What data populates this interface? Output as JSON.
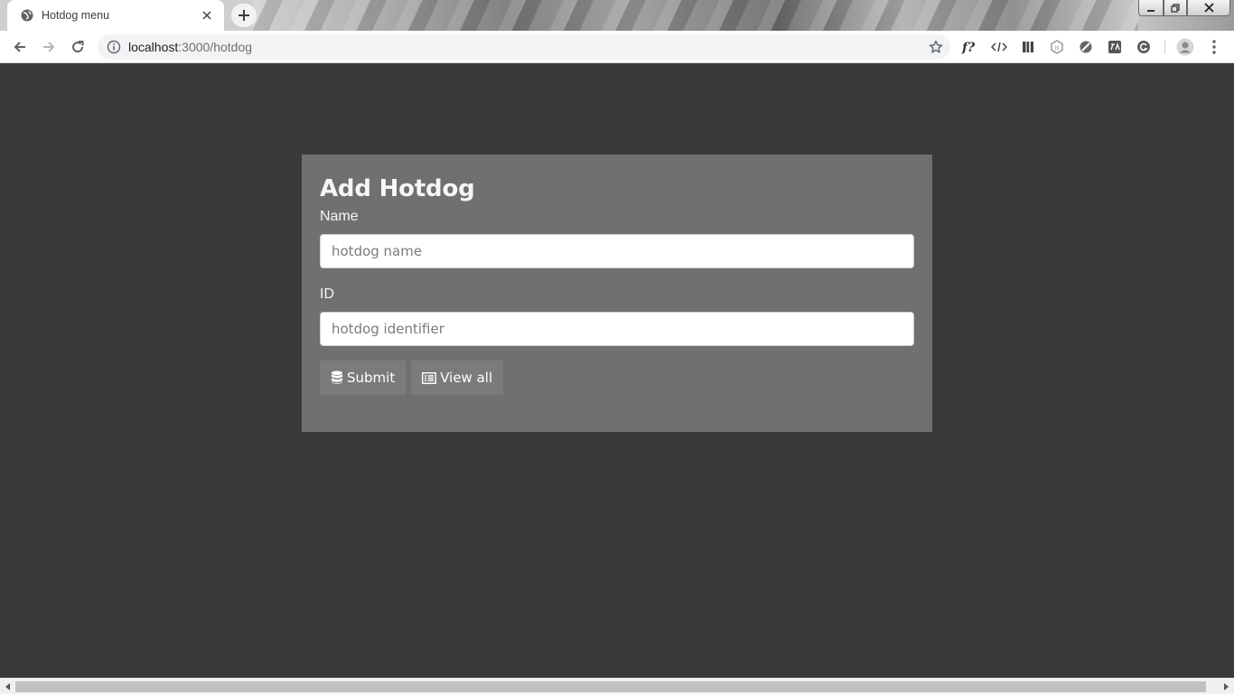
{
  "browser": {
    "tab_title": "Hotdog menu",
    "url_host": "localhost",
    "url_rest": ":3000/hotdog"
  },
  "page": {
    "title": "Add Hotdog",
    "name_label": "Name",
    "name_placeholder": "hotdog name",
    "id_label": "ID",
    "id_placeholder": "hotdog identifier",
    "submit_label": "Submit",
    "view_all_label": "View all"
  },
  "colors": {
    "page_background": "#393939",
    "card_background": "#707070",
    "button_background": "#7b7b7b"
  },
  "icons": [
    "globe-icon",
    "close-icon",
    "plus-icon",
    "back-icon",
    "forward-icon",
    "reload-icon",
    "info-icon",
    "star-icon",
    "database-icon",
    "list-icon",
    "profile-icon",
    "menu-dots-icon"
  ]
}
